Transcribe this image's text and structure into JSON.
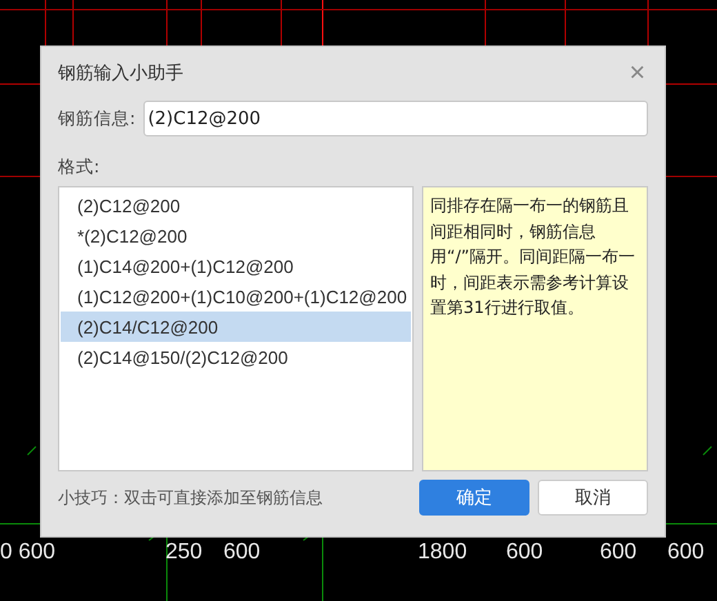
{
  "canvas": {
    "dimension_labels": [
      "0 600",
      "250",
      "600",
      "1800",
      "600",
      "600",
      "600"
    ]
  },
  "dialog": {
    "title": "钢筋输入小助手",
    "close": "×",
    "field": {
      "label": "钢筋信息:",
      "value": "(2)C12@200"
    },
    "format_label": "格式:",
    "formats": [
      {
        "text": "(2)C12@200",
        "selected": false
      },
      {
        "text": "*(2)C12@200",
        "selected": false
      },
      {
        "text": "(1)C14@200+(1)C12@200",
        "selected": false
      },
      {
        "text": "(1)C12@200+(1)C10@200+(1)C12@200",
        "selected": false
      },
      {
        "text": "(2)C14/C12@200",
        "selected": true
      },
      {
        "text": "(2)C14@150/(2)C12@200",
        "selected": false
      }
    ],
    "help": "同排存在隔一布一的钢筋且间距相同时，钢筋信息用“/”隔开。同间距隔一布一时，间距表示需参考计算设置第31行进行取值。",
    "tip": "小技巧：双击可直接添加至钢筋信息",
    "buttons": [
      {
        "label": "确定",
        "kind": "primary"
      },
      {
        "label": "取消",
        "kind": "secondary"
      }
    ]
  }
}
